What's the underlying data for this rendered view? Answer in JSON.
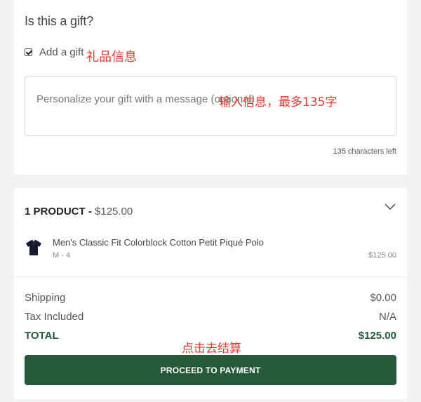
{
  "gift": {
    "title": "Is this a gift?",
    "checkbox_label": "Add a gift",
    "checkbox_checked": true,
    "annotation": "礼品信息",
    "message_placeholder": "Personalize your gift with a message (optional)",
    "message_annotation": "输入信息，最多135字",
    "characters_left": "135 characters left"
  },
  "summary": {
    "product_count": "1 PRODUCT",
    "separator": " - ",
    "product_total": "$125.00",
    "product": {
      "name": "Men's Classic Fit Colorblock Cotton Petit Piqué Polo",
      "variant": "M - 4",
      "price": "$125.00",
      "icon": "polo-shirt-icon"
    },
    "shipping_label": "Shipping",
    "shipping_value": "$0.00",
    "tax_label": "Tax Included",
    "tax_value": "N/A",
    "total_label": "TOTAL",
    "total_value": "$125.00",
    "checkout_annotation": "点击去结算",
    "pay_button": "PROCEED TO PAYMENT"
  },
  "colors": {
    "accent_green": "#275a3b",
    "total_green": "#1f5c38",
    "annotation_red": "#e03a2f",
    "background": "#f2f2f2"
  }
}
